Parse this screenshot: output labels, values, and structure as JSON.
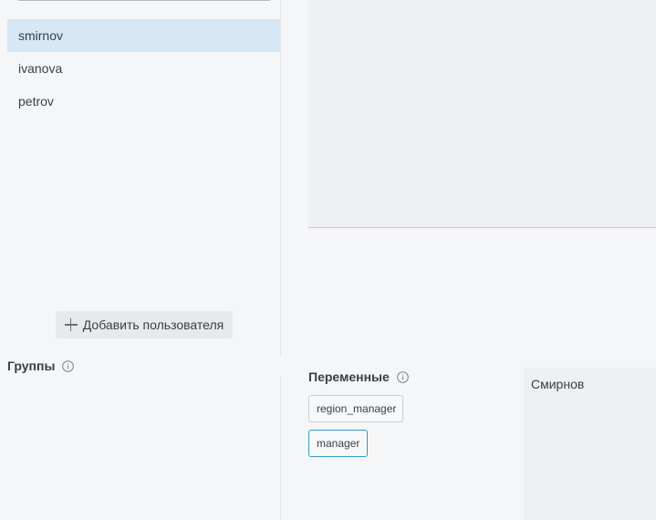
{
  "users": {
    "items": [
      {
        "label": "smirnov",
        "selected": true
      },
      {
        "label": "ivanova",
        "selected": false
      },
      {
        "label": "petrov",
        "selected": false
      }
    ],
    "add_button_label": "Добавить пользователя",
    "selected_color": "#d6e8f5"
  },
  "groups": {
    "title": "Группы",
    "info_icon": "info-icon"
  },
  "variables": {
    "title": "Переменные",
    "info_icon": "info-icon",
    "chips": [
      {
        "label": "region_manager",
        "active": false
      },
      {
        "label": "manager",
        "active": true
      }
    ],
    "active_border_color": "#2e9ccf"
  },
  "value_panel": {
    "value": "Смирнов"
  }
}
